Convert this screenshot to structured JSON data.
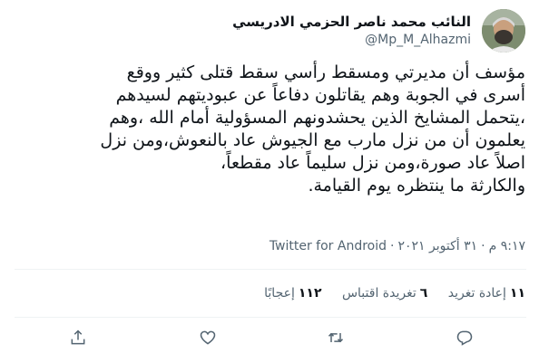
{
  "author": {
    "display_name": "النائب محمد ناصر الحزمي الادريسي",
    "handle": "@Mp_M_Alhazmi"
  },
  "tweet": {
    "lines": [
      "مؤسف أن مديرتي ومسقط رأسي سقط قتلى كثير ووقع",
      "أسرى في الجوبة وهم يقاتلون دفاعاً عن عبوديتهم لسيدهم",
      "،يتحمل المشايخ الذين يحشدونهم المسؤولية أمام الله ،وهم",
      "يعلمون أن من نزل مارب مع الجيوش عاد بالنعوش،ومن نزل",
      "اصلاً عاد صورة،ومن نزل سليماً عاد مقطعاً،",
      "والكارثة ما ينتظره يوم القيامة."
    ]
  },
  "meta": {
    "time": "٩:١٧ م",
    "date": "٣١ أكتوبر ٢٠٢١",
    "dot": "·",
    "source": "Twitter for Android"
  },
  "stats": {
    "retweets_count": "١١",
    "retweets_label": "إعادة تغريد",
    "quotes_count": "٦",
    "quotes_label": "تغريدة اقتباس",
    "likes_count": "١١٢",
    "likes_label": "إعجابًا"
  },
  "actions": [
    "reply-icon",
    "retweet-icon",
    "like-icon",
    "share-icon"
  ],
  "colors": {
    "text": "#0f1419",
    "secondary": "#536471",
    "divider": "#eff3f4"
  }
}
